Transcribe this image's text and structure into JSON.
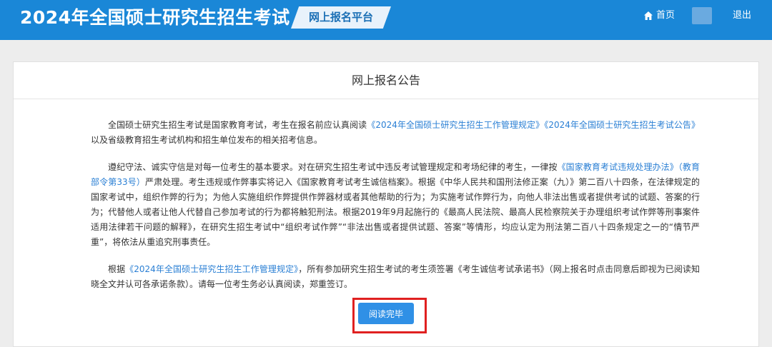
{
  "header": {
    "title": "2024年全国硕士研究生招生考试",
    "platform": "网上报名平台",
    "home_label": "首页",
    "logout_label": "退出"
  },
  "notice": {
    "title": "网上报名公告",
    "p1": {
      "text_a": "全国硕士研究生招生考试是国家教育考试，考生在报名前应认真阅读",
      "link1": "《2024年全国硕士研究生招生工作管理规定》",
      "link2": "《2024年全国硕士研究生招生考试公告》",
      "text_b": "以及省级教育招生考试机构和招生单位发布的相关招考信息。"
    },
    "p2": {
      "text_a": "遵纪守法、诚实守信是对每一位考生的基本要求。对在研究生招生考试中违反考试管理规定和考场纪律的考生，一律按",
      "link1": "《国家教育考试违规处理办法》（教育部令第33号）",
      "text_b": "严肃处理。考生违规或作弊事实将记入《国家教育考试考生诚信档案》。根据《中华人民共和国刑法修正案（九）》第二百八十四条，在法律规定的国家考试中，组织作弊的行为；为他人实施组织作弊提供作弊器材或者其他帮助的行为；为实施考试作弊行为，向他人非法出售或者提供考试的试题、答案的行为；代替他人或者让他人代替自己参加考试的行为都将触犯刑法。根据2019年9月起施行的《最高人民法院、最高人民检察院关于办理组织考试作弊等刑事案件适用法律若干问题的解释》，在研究生招生考试中“组织考试作弊”“非法出售或者提供试题、答案”等情形，均应认定为刑法第二百八十四条规定之一的“情节严重”，将依法从重追究刑事责任。"
    },
    "p3": {
      "text_a": "根据",
      "link1": "《2024年全国硕士研究生招生工作管理规定》",
      "text_b": "，所有参加研究生招生考试的考生须签署《考生诚信考试承诺书》（网上报名时点击同意后即视为已阅读知晓全文并认可各承诺条款）。请每一位考生务必认真阅读，郑重签订。"
    },
    "button_label": "阅读完毕"
  },
  "colors": {
    "header_bg": "#1a87d7",
    "link": "#2a7fd4",
    "button": "#2f90e6",
    "highlight_border": "#e02020"
  }
}
